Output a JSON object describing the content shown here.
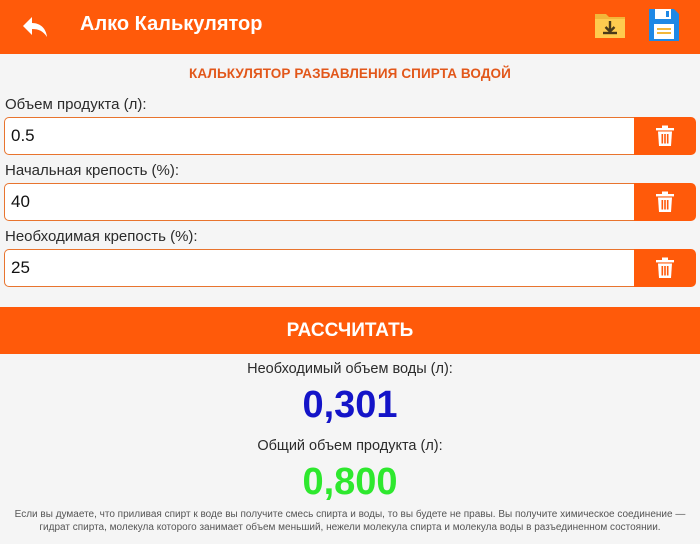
{
  "appbar": {
    "title": "Алко Калькулятор",
    "icons": {
      "back": "back-arrow-icon",
      "folder": "folder-download-icon",
      "save": "floppy-save-icon"
    }
  },
  "calculator": {
    "title": "КАЛЬКУЛЯТОР РАЗБАВЛЕНИЯ СПИРТА ВОДОЙ",
    "fields": [
      {
        "label": "Объем продукта (л):",
        "value": "0.5"
      },
      {
        "label": "Начальная крепость (%):",
        "value": "40"
      },
      {
        "label": "Необходимая крепость (%):",
        "value": "25"
      }
    ],
    "calculate_label": "РАССЧИТАТЬ"
  },
  "results": {
    "water_label": "Необходимый объем воды (л):",
    "water_value": "0,301",
    "total_label": "Общий объем продукта (л):",
    "total_value": "0,800"
  },
  "note": "Если вы думаете, что приливая спирт к воде вы получите смесь спирта и воды, то вы будете не правы. Вы получите химическое соединение — гидрат спирта, молекула которого занимает объем меньший, нежели молекула спирта и молекула воды в разъединенном состоянии.",
  "colors": {
    "accent": "#ff5a0a",
    "water_value": "#1414c8",
    "total_value": "#2ee82e"
  }
}
